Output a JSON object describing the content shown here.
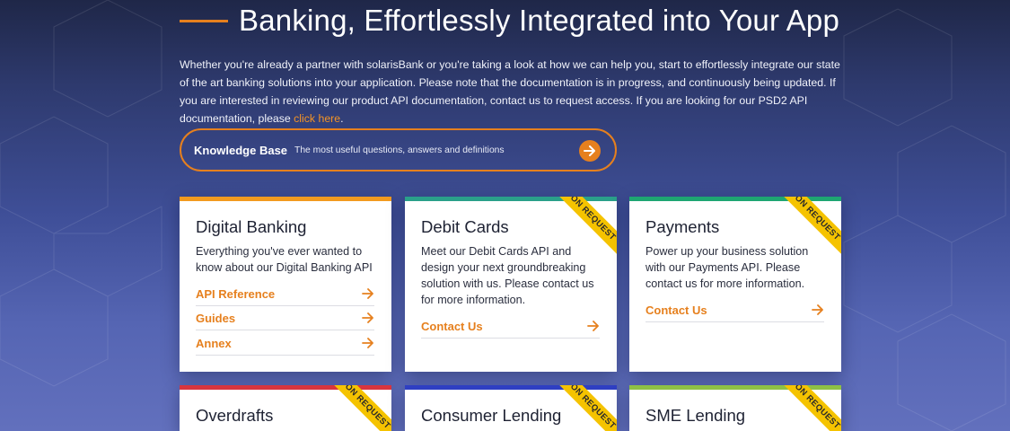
{
  "hero": {
    "title": "Banking, Effortlessly Integrated into Your App"
  },
  "intro": {
    "text": "Whether you're already a partner with solarisBank or you're taking a look at how we can help you, start to effortlessly integrate our state of the art banking solutions into your application. Please note that the documentation is in progress, and continuously being updated. If you are interested in reviewing our product API documentation, contact us to request access. If you are looking for our PSD2 API documentation, please ",
    "link": "click here",
    "tail": "."
  },
  "knowledge_base": {
    "title": "Knowledge Base",
    "subtitle": "The most useful questions, answers and definitions"
  },
  "ribbon_label": "ON REQUEST",
  "colors": {
    "accent": "#e6801e",
    "digital_banking": "#f29a1f",
    "debit_cards": "#2aa08a",
    "payments": "#1ea672",
    "overdrafts": "#d8353e",
    "consumer_lending": "#2f3fc2",
    "sme_lending": "#8ec045",
    "ribbon": "#f5c300"
  },
  "cards": [
    {
      "title": "Digital Banking",
      "desc": "Everything you've ever wanted to know about our Digital Banking API",
      "links": [
        "API Reference",
        "Guides",
        "Annex"
      ]
    },
    {
      "title": "Debit Cards",
      "desc": "Meet our Debit Cards API and design your next groundbreaking solution with us. Please contact us for more information.",
      "links": [
        "Contact Us"
      ]
    },
    {
      "title": "Payments",
      "desc": "Power up your business solution with our Payments API. Please contact us for more information.",
      "links": [
        "Contact Us"
      ]
    },
    {
      "title": "Overdrafts"
    },
    {
      "title": "Consumer Lending"
    },
    {
      "title": "SME Lending"
    }
  ]
}
